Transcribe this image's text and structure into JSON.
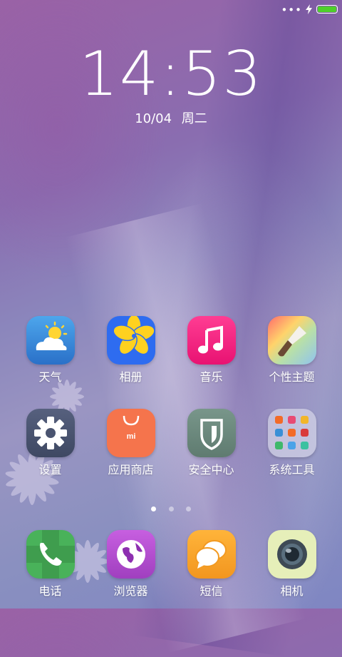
{
  "status_bar": {
    "dots": "•••",
    "charging": true,
    "battery_level": 1.0,
    "battery_color": "#4fd02b"
  },
  "lockclock": {
    "time": "14:53",
    "date": "10/04",
    "weekday": "周二"
  },
  "apps_row1": [
    {
      "label": "天气",
      "icon": "weather-icon"
    },
    {
      "label": "相册",
      "icon": "gallery-icon"
    },
    {
      "label": "音乐",
      "icon": "music-icon"
    },
    {
      "label": "个性主题",
      "icon": "themes-icon"
    }
  ],
  "apps_row2": [
    {
      "label": "设置",
      "icon": "settings-icon"
    },
    {
      "label": "应用商店",
      "icon": "app-store-icon",
      "badge_text": "mi"
    },
    {
      "label": "安全中心",
      "icon": "security-center-icon"
    },
    {
      "label": "系统工具",
      "icon": "system-tools-folder-icon"
    }
  ],
  "page_indicator": {
    "count": 3,
    "active": 1
  },
  "dock": [
    {
      "label": "电话",
      "icon": "phone-icon"
    },
    {
      "label": "浏览器",
      "icon": "browser-icon"
    },
    {
      "label": "短信",
      "icon": "messages-icon"
    },
    {
      "label": "相机",
      "icon": "camera-icon"
    }
  ],
  "colors": {
    "weather": "#3b8fde",
    "gallery": "#2e6cf0",
    "music": "#f0217e",
    "settings": "#4a5470",
    "store": "#f5744c",
    "security": "#6e8a7f",
    "phone": "#49b25a",
    "browser": "#b54fcf",
    "messages": "#f5a52b",
    "camera": "#e6efb9"
  }
}
